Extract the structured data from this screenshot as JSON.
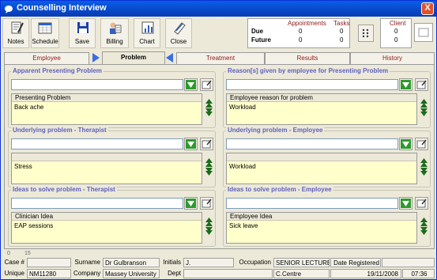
{
  "window": {
    "title": "Counselling Interview",
    "close_glyph": "X"
  },
  "toolbar": {
    "buttons": [
      {
        "label": "Notes",
        "icon": "notes-icon"
      },
      {
        "label": "Schedule",
        "icon": "schedule-icon"
      },
      {
        "label": "Save",
        "icon": "save-icon"
      },
      {
        "label": "Billing",
        "icon": "billing-icon"
      },
      {
        "label": "Chart",
        "icon": "chart-icon"
      },
      {
        "label": "Close",
        "icon": "close-doc-icon"
      }
    ],
    "summary": {
      "headers": {
        "appointments": "Appointments",
        "tasks": "Tasks",
        "client": "Client"
      },
      "rows": [
        {
          "label": "Due",
          "appointments": "0",
          "tasks": "0",
          "client": "0"
        },
        {
          "label": "Future",
          "appointments": "0",
          "tasks": "0",
          "client": "0"
        }
      ]
    }
  },
  "tabs": [
    {
      "label": "Employee",
      "active": false
    },
    {
      "label": "Problem",
      "active": true
    },
    {
      "label": "Treatment",
      "active": false
    },
    {
      "label": "Results",
      "active": false
    },
    {
      "label": "History",
      "active": false
    }
  ],
  "groups": [
    {
      "title": "Apparent Presenting Problem",
      "combo_value": "",
      "inner_header": "Presenting Problem",
      "inner_text": "Back ache"
    },
    {
      "title": "Reason[s] given by employee for Presenting Problem",
      "combo_value": "",
      "inner_header": "Employee reason for problem",
      "inner_text": "Workload"
    },
    {
      "title": "Underlying problem - Therapist",
      "combo_value": "",
      "inner_header": "",
      "inner_text": "Stress"
    },
    {
      "title": "Underlying problem - Employee",
      "combo_value": "",
      "inner_header": "",
      "inner_text": "Workload"
    },
    {
      "title": "Ideas to solve problem - Therapist",
      "combo_value": "",
      "inner_header": "Clinician Idea",
      "inner_text": "EAP sessions"
    },
    {
      "title": "Ideas to solve problem - Employee",
      "combo_value": "",
      "inner_header": "Employee Idea",
      "inner_text": "Sick leave"
    }
  ],
  "status": {
    "scale": [
      "0",
      "15"
    ],
    "row1": {
      "case_label": "Case #",
      "case_value": "",
      "surname_label": "Surname",
      "surname_value": "Dr Gulbranson",
      "initials_label": "Initials",
      "initials_value": "J.",
      "occupation_label": "Occupation",
      "occupation_value": "SENIOR LECTURE",
      "date_registered_label": "Date Registered",
      "date_registered_value": ""
    },
    "row2": {
      "unique_label": "Unique",
      "unique_value": "NM11280",
      "company_label": "Company",
      "company_value": "Massey University",
      "dept_label": "Dept",
      "dept_value": "",
      "centre_value": "C.Centre",
      "date": "19/11/2008",
      "time": "07:36"
    }
  },
  "colors": {
    "titlebar": "#0848c8",
    "group_title": "#6060c0",
    "tab_text": "#8b1a1a",
    "note_bg": "#ffffcc",
    "go_button": "#2e9a2e"
  }
}
